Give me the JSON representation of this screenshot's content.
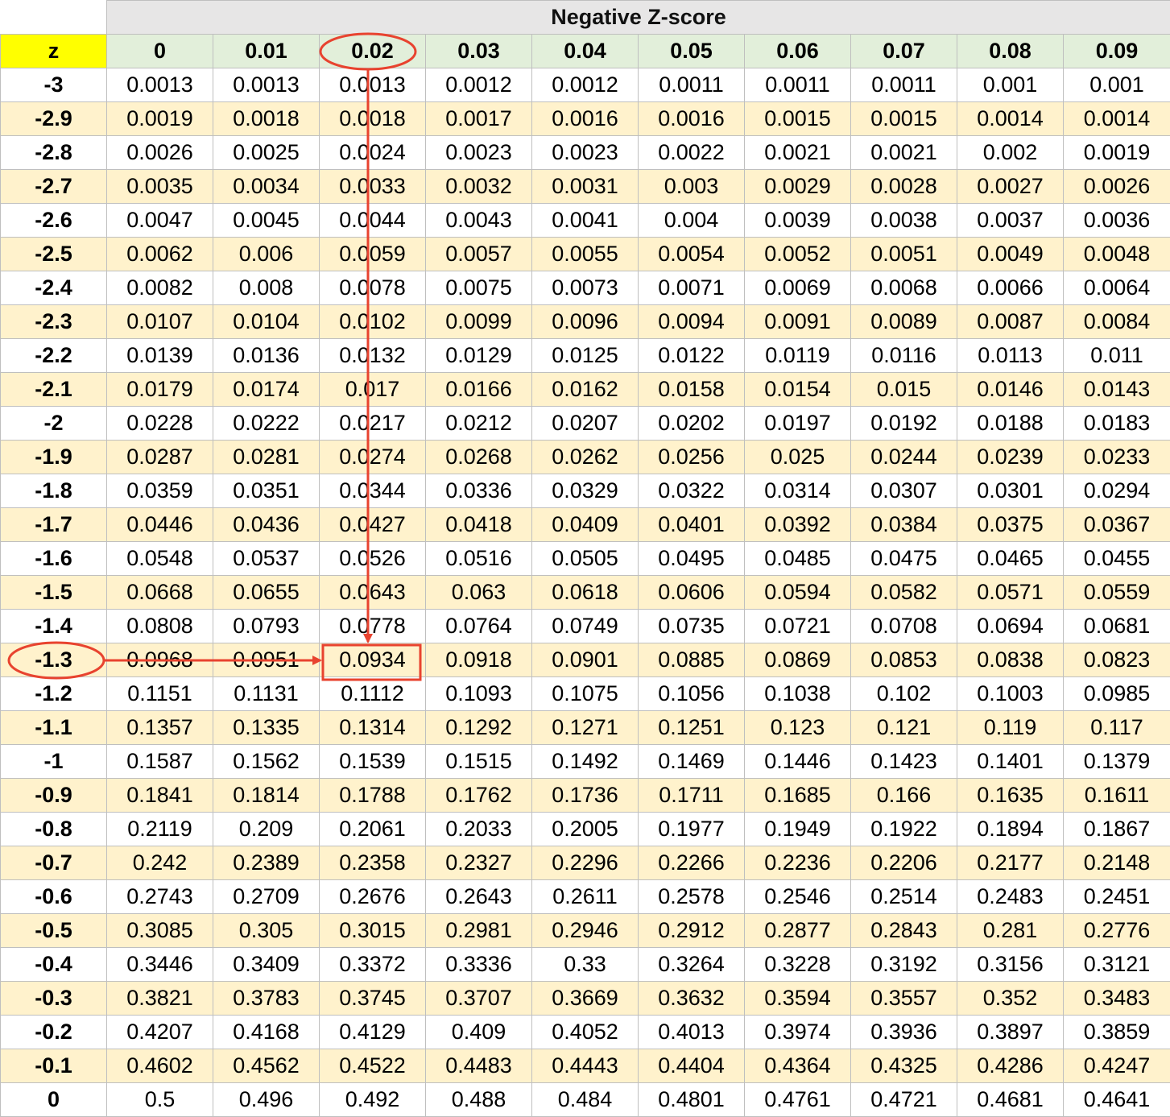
{
  "title": "Negative Z-score",
  "z_header": "z",
  "columns": [
    "0",
    "0.01",
    "0.02",
    "0.03",
    "0.04",
    "0.05",
    "0.06",
    "0.07",
    "0.08",
    "0.09"
  ],
  "highlight": {
    "row_z": "-1.3",
    "col": "0.02",
    "value": "0.0934"
  },
  "colors": {
    "arrow": "#e8432f",
    "z_header_bg": "#ffff00",
    "col_header_bg": "#e2efda",
    "stripe_bg": "#fff2cc",
    "title_bg": "#e7e6e6"
  },
  "rows": [
    {
      "z": "-3",
      "values": [
        "0.0013",
        "0.0013",
        "0.0013",
        "0.0012",
        "0.0012",
        "0.0011",
        "0.0011",
        "0.0011",
        "0.001",
        "0.001"
      ]
    },
    {
      "z": "-2.9",
      "values": [
        "0.0019",
        "0.0018",
        "0.0018",
        "0.0017",
        "0.0016",
        "0.0016",
        "0.0015",
        "0.0015",
        "0.0014",
        "0.0014"
      ]
    },
    {
      "z": "-2.8",
      "values": [
        "0.0026",
        "0.0025",
        "0.0024",
        "0.0023",
        "0.0023",
        "0.0022",
        "0.0021",
        "0.0021",
        "0.002",
        "0.0019"
      ]
    },
    {
      "z": "-2.7",
      "values": [
        "0.0035",
        "0.0034",
        "0.0033",
        "0.0032",
        "0.0031",
        "0.003",
        "0.0029",
        "0.0028",
        "0.0027",
        "0.0026"
      ]
    },
    {
      "z": "-2.6",
      "values": [
        "0.0047",
        "0.0045",
        "0.0044",
        "0.0043",
        "0.0041",
        "0.004",
        "0.0039",
        "0.0038",
        "0.0037",
        "0.0036"
      ]
    },
    {
      "z": "-2.5",
      "values": [
        "0.0062",
        "0.006",
        "0.0059",
        "0.0057",
        "0.0055",
        "0.0054",
        "0.0052",
        "0.0051",
        "0.0049",
        "0.0048"
      ]
    },
    {
      "z": "-2.4",
      "values": [
        "0.0082",
        "0.008",
        "0.0078",
        "0.0075",
        "0.0073",
        "0.0071",
        "0.0069",
        "0.0068",
        "0.0066",
        "0.0064"
      ]
    },
    {
      "z": "-2.3",
      "values": [
        "0.0107",
        "0.0104",
        "0.0102",
        "0.0099",
        "0.0096",
        "0.0094",
        "0.0091",
        "0.0089",
        "0.0087",
        "0.0084"
      ]
    },
    {
      "z": "-2.2",
      "values": [
        "0.0139",
        "0.0136",
        "0.0132",
        "0.0129",
        "0.0125",
        "0.0122",
        "0.0119",
        "0.0116",
        "0.0113",
        "0.011"
      ]
    },
    {
      "z": "-2.1",
      "values": [
        "0.0179",
        "0.0174",
        "0.017",
        "0.0166",
        "0.0162",
        "0.0158",
        "0.0154",
        "0.015",
        "0.0146",
        "0.0143"
      ]
    },
    {
      "z": "-2",
      "values": [
        "0.0228",
        "0.0222",
        "0.0217",
        "0.0212",
        "0.0207",
        "0.0202",
        "0.0197",
        "0.0192",
        "0.0188",
        "0.0183"
      ]
    },
    {
      "z": "-1.9",
      "values": [
        "0.0287",
        "0.0281",
        "0.0274",
        "0.0268",
        "0.0262",
        "0.0256",
        "0.025",
        "0.0244",
        "0.0239",
        "0.0233"
      ]
    },
    {
      "z": "-1.8",
      "values": [
        "0.0359",
        "0.0351",
        "0.0344",
        "0.0336",
        "0.0329",
        "0.0322",
        "0.0314",
        "0.0307",
        "0.0301",
        "0.0294"
      ]
    },
    {
      "z": "-1.7",
      "values": [
        "0.0446",
        "0.0436",
        "0.0427",
        "0.0418",
        "0.0409",
        "0.0401",
        "0.0392",
        "0.0384",
        "0.0375",
        "0.0367"
      ]
    },
    {
      "z": "-1.6",
      "values": [
        "0.0548",
        "0.0537",
        "0.0526",
        "0.0516",
        "0.0505",
        "0.0495",
        "0.0485",
        "0.0475",
        "0.0465",
        "0.0455"
      ]
    },
    {
      "z": "-1.5",
      "values": [
        "0.0668",
        "0.0655",
        "0.0643",
        "0.063",
        "0.0618",
        "0.0606",
        "0.0594",
        "0.0582",
        "0.0571",
        "0.0559"
      ]
    },
    {
      "z": "-1.4",
      "values": [
        "0.0808",
        "0.0793",
        "0.0778",
        "0.0764",
        "0.0749",
        "0.0735",
        "0.0721",
        "0.0708",
        "0.0694",
        "0.0681"
      ]
    },
    {
      "z": "-1.3",
      "values": [
        "0.0968",
        "0.0951",
        "0.0934",
        "0.0918",
        "0.0901",
        "0.0885",
        "0.0869",
        "0.0853",
        "0.0838",
        "0.0823"
      ]
    },
    {
      "z": "-1.2",
      "values": [
        "0.1151",
        "0.1131",
        "0.1112",
        "0.1093",
        "0.1075",
        "0.1056",
        "0.1038",
        "0.102",
        "0.1003",
        "0.0985"
      ]
    },
    {
      "z": "-1.1",
      "values": [
        "0.1357",
        "0.1335",
        "0.1314",
        "0.1292",
        "0.1271",
        "0.1251",
        "0.123",
        "0.121",
        "0.119",
        "0.117"
      ]
    },
    {
      "z": "-1",
      "values": [
        "0.1587",
        "0.1562",
        "0.1539",
        "0.1515",
        "0.1492",
        "0.1469",
        "0.1446",
        "0.1423",
        "0.1401",
        "0.1379"
      ]
    },
    {
      "z": "-0.9",
      "values": [
        "0.1841",
        "0.1814",
        "0.1788",
        "0.1762",
        "0.1736",
        "0.1711",
        "0.1685",
        "0.166",
        "0.1635",
        "0.1611"
      ]
    },
    {
      "z": "-0.8",
      "values": [
        "0.2119",
        "0.209",
        "0.2061",
        "0.2033",
        "0.2005",
        "0.1977",
        "0.1949",
        "0.1922",
        "0.1894",
        "0.1867"
      ]
    },
    {
      "z": "-0.7",
      "values": [
        "0.242",
        "0.2389",
        "0.2358",
        "0.2327",
        "0.2296",
        "0.2266",
        "0.2236",
        "0.2206",
        "0.2177",
        "0.2148"
      ]
    },
    {
      "z": "-0.6",
      "values": [
        "0.2743",
        "0.2709",
        "0.2676",
        "0.2643",
        "0.2611",
        "0.2578",
        "0.2546",
        "0.2514",
        "0.2483",
        "0.2451"
      ]
    },
    {
      "z": "-0.5",
      "values": [
        "0.3085",
        "0.305",
        "0.3015",
        "0.2981",
        "0.2946",
        "0.2912",
        "0.2877",
        "0.2843",
        "0.281",
        "0.2776"
      ]
    },
    {
      "z": "-0.4",
      "values": [
        "0.3446",
        "0.3409",
        "0.3372",
        "0.3336",
        "0.33",
        "0.3264",
        "0.3228",
        "0.3192",
        "0.3156",
        "0.3121"
      ]
    },
    {
      "z": "-0.3",
      "values": [
        "0.3821",
        "0.3783",
        "0.3745",
        "0.3707",
        "0.3669",
        "0.3632",
        "0.3594",
        "0.3557",
        "0.352",
        "0.3483"
      ]
    },
    {
      "z": "-0.2",
      "values": [
        "0.4207",
        "0.4168",
        "0.4129",
        "0.409",
        "0.4052",
        "0.4013",
        "0.3974",
        "0.3936",
        "0.3897",
        "0.3859"
      ]
    },
    {
      "z": "-0.1",
      "values": [
        "0.4602",
        "0.4562",
        "0.4522",
        "0.4483",
        "0.4443",
        "0.4404",
        "0.4364",
        "0.4325",
        "0.4286",
        "0.4247"
      ]
    },
    {
      "z": "0",
      "values": [
        "0.5",
        "0.496",
        "0.492",
        "0.488",
        "0.484",
        "0.4801",
        "0.4761",
        "0.4721",
        "0.4681",
        "0.4641"
      ]
    }
  ]
}
